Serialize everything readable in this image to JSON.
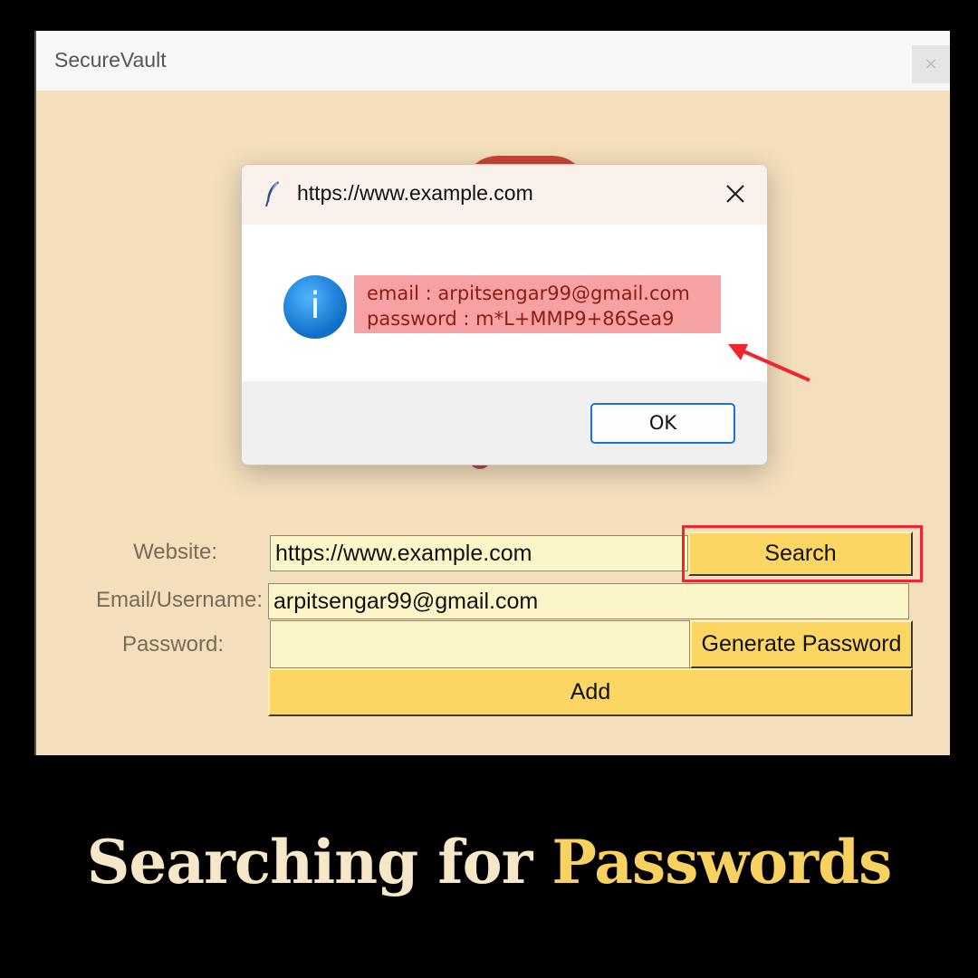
{
  "app": {
    "title": "SecureVault",
    "close_glyph": "×"
  },
  "form": {
    "website_label": "Website:",
    "website_value": "https://www.example.com",
    "search_label": "Search",
    "email_label": "Email/Username:",
    "email_value": "arpitsengar99@gmail.com",
    "password_label": "Password:",
    "password_value": "",
    "generate_label": "Generate Password",
    "add_label": "Add"
  },
  "dialog": {
    "title": "https://www.example.com",
    "info_glyph": "i",
    "message_line1": "email : arpitsengar99@gmail.com",
    "message_line2": "password : m*L+MMP9+86Sea9",
    "ok_label": "OK"
  },
  "caption": {
    "part1": "Searching for ",
    "part2": "Passwords"
  },
  "colors": {
    "window_bg": "#f3dfbb",
    "button": "#fcd662",
    "entry_bg": "#fcf5c8",
    "highlight": "#f0252d",
    "caption_accent": "#f9d15e"
  },
  "icons": [
    "feather-icon",
    "info-icon",
    "close-icon",
    "arrow-icon"
  ]
}
